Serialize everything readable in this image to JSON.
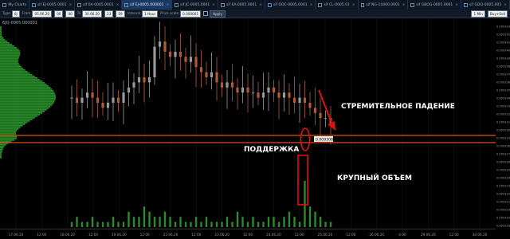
{
  "tabs": [
    {
      "label": "My Charts",
      "active": false
    },
    {
      "label": "sif EJ-0005.0001",
      "active": false
    },
    {
      "label": "sif 0A-0005.0001",
      "active": false
    },
    {
      "label": "sif EJ-0005.000001",
      "active": true
    },
    {
      "label": "sif JC-0005.0001",
      "active": false
    },
    {
      "label": "sif 6A-0005.0001",
      "active": false
    },
    {
      "label": "sif OOC-0005.0001",
      "active": false
    },
    {
      "label": "sif CL-0005.01",
      "active": false
    },
    {
      "label": "sif NG-14400.0001",
      "active": false
    },
    {
      "label": "sif GBOG-0005.0001",
      "active": false
    },
    {
      "label": "sif GDQ-0005.005",
      "active": false
    }
  ],
  "toolbar": {
    "type_label": "Type",
    "type_value": "6J",
    "from_label": "From",
    "from_value": "05.06.20",
    "h1": "00",
    "m1": "00",
    "to_label": "To",
    "to_value": "30.06.20",
    "h2": "23",
    "m2": "59",
    "interval_label": "Interval",
    "interval_value": "1 Hour",
    "step_label": "Price scale",
    "step_value": "0.000001",
    "apply_label": "Apply",
    "right_select": "1 Min",
    "right_select2": "Buy+Sell"
  },
  "chart_header": "6JQ-0005.000001",
  "annotations": {
    "fall": "СТРЕМИТЕЛЬНОЕ ПАДЕНИЕ",
    "support": "ПОДДЕРЖКА",
    "volume": "КРУПНЫЙ ОБЪЕМ",
    "price_tag": "0.009308"
  },
  "colors": {
    "up": "#9a9a9a",
    "down": "#b05a36",
    "profile": "#2ea02e",
    "volume": "#2c8a2c",
    "support": "#e05010",
    "highlight": "#e01010"
  },
  "chart_data": {
    "type": "candlestick",
    "x_ticks": [
      "17.06.20",
      "12:00",
      "18.06.20",
      "12:00",
      "19.06.20",
      "12:00",
      "22.06.20",
      "12:00",
      "23.06.20",
      "12:00",
      "24.06.20",
      "12:00",
      "25.06.20",
      "12:00",
      "26.06.20",
      "4:00",
      "29.06.20",
      "12:00",
      "30.06.20"
    ],
    "y_ticks": [
      "0.009343",
      "0.009342",
      "0.009341",
      "0.009340",
      "0.009339",
      "0.009338",
      "0.009337",
      "0.009336",
      "0.009335",
      "0.009334",
      "0.009333",
      "0.009332",
      "0.009331",
      "0.009330",
      "0.009329",
      "0.009328",
      "0.009327",
      "0.009326",
      "0.009325",
      "0.009324",
      "0.009323",
      "0.009322",
      "0.009321",
      "0.009320",
      "0.009319",
      "0.009318"
    ],
    "price_range": [
      0.009318,
      0.009343
    ],
    "closes": [
      0.009329,
      0.009328,
      0.009329,
      0.00933,
      0.009329,
      0.009328,
      0.009327,
      0.009328,
      0.009329,
      0.009328,
      0.00933,
      0.009331,
      0.009332,
      0.009333,
      0.009332,
      0.009333,
      0.009339,
      0.00934,
      0.009338,
      0.009337,
      0.009338,
      0.009337,
      0.009336,
      0.009337,
      0.009335,
      0.009334,
      0.009333,
      0.009334,
      0.009332,
      0.009331,
      0.009332,
      0.009331,
      0.00933,
      0.009331,
      0.00933,
      0.00933,
      0.009329,
      0.00933,
      0.009331,
      0.00933,
      0.009329,
      0.00933,
      0.009329,
      0.009328,
      0.009329,
      0.009328,
      0.009327,
      0.009326,
      0.009325,
      0.009325,
      0.009324
    ],
    "volumes": [
      1,
      2,
      1,
      1,
      2,
      1,
      1,
      1,
      2,
      1,
      1,
      3,
      2,
      2,
      4,
      3,
      2,
      2,
      3,
      2,
      1,
      2,
      1,
      1,
      2,
      1,
      2,
      1,
      1,
      1,
      2,
      1,
      3,
      2,
      1,
      2,
      1,
      1,
      2,
      2,
      1,
      2,
      3,
      2,
      1,
      9,
      4,
      3,
      2,
      1,
      1
    ]
  }
}
